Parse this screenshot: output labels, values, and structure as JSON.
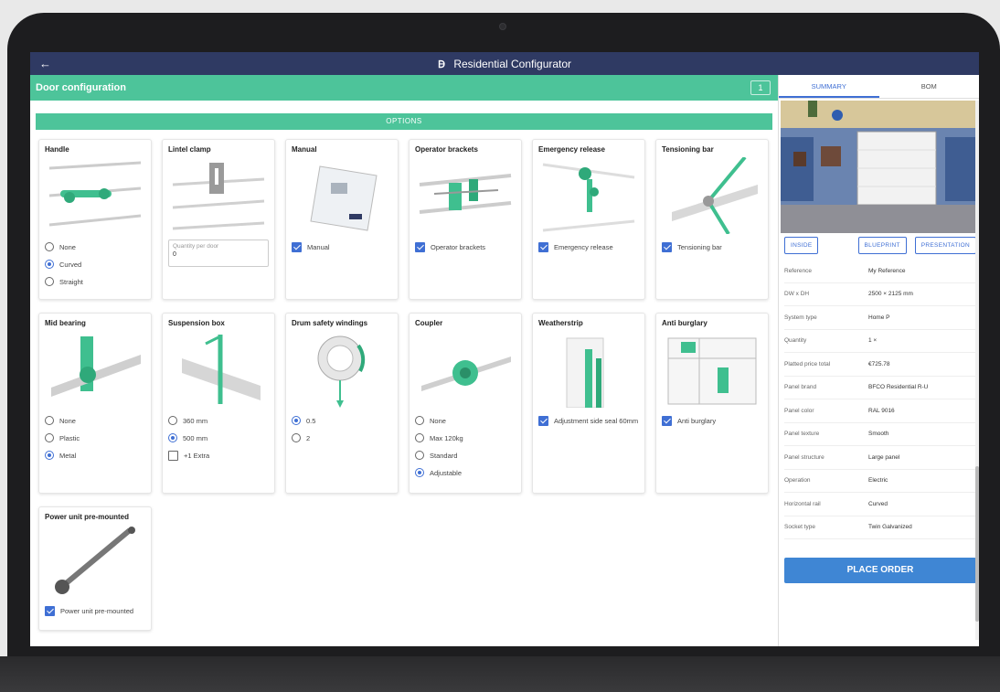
{
  "app": {
    "title": "Residential Configurator",
    "logo": "Ꟈ"
  },
  "config": {
    "title": "Door configuration",
    "badge": "1",
    "options_label": "OPTIONS"
  },
  "cards": {
    "handle": {
      "title": "Handle",
      "options": [
        "None",
        "Curved",
        "Straight"
      ],
      "selected": "Curved"
    },
    "lintel": {
      "title": "Lintel clamp",
      "qty_label": "Quantity per door",
      "qty_value": "0"
    },
    "manual": {
      "title": "Manual",
      "check": "Manual"
    },
    "operator": {
      "title": "Operator brackets",
      "check": "Operator brackets"
    },
    "emergency": {
      "title": "Emergency release",
      "check": "Emergency release"
    },
    "tensioning": {
      "title": "Tensioning bar",
      "check": "Tensioning bar"
    },
    "midbearing": {
      "title": "Mid bearing",
      "options": [
        "None",
        "Plastic",
        "Metal"
      ],
      "selected": "Metal"
    },
    "suspension": {
      "title": "Suspension box",
      "options": [
        "360 mm",
        "500 mm"
      ],
      "selected": "500 mm",
      "extra": "+1 Extra"
    },
    "drum": {
      "title": "Drum safety windings",
      "options": [
        "0.5",
        "2"
      ],
      "selected": "0.5"
    },
    "coupler": {
      "title": "Coupler",
      "options": [
        "None",
        "Max 120kg",
        "Standard",
        "Adjustable"
      ],
      "selected": "Adjustable"
    },
    "weatherstrip": {
      "title": "Weatherstrip",
      "check": "Adjustment side seal 60mm"
    },
    "antiburglary": {
      "title": "Anti burglary",
      "check": "Anti burglary"
    },
    "powerunit": {
      "title": "Power unit pre-mounted",
      "check": "Power unit pre-mounted"
    }
  },
  "sidebar": {
    "tabs": [
      "SUMMARY",
      "BOM"
    ],
    "buttons": [
      "INSIDE",
      "BLUEPRINT",
      "PRESENTATION"
    ],
    "specs": [
      {
        "k": "Reference",
        "v": "My Reference"
      },
      {
        "k": "DW x DH",
        "v": "2500 × 2125 mm"
      },
      {
        "k": "System type",
        "v": "Home P"
      },
      {
        "k": "Quantity",
        "v": "1 ×"
      },
      {
        "k": "Platted price total",
        "v": "€725.78"
      },
      {
        "k": "Panel brand",
        "v": "BFCO Residential R-U"
      },
      {
        "k": "Panel color",
        "v": "RAL 9016"
      },
      {
        "k": "Panel texture",
        "v": "Smooth"
      },
      {
        "k": "Panel structure",
        "v": "Large panel"
      },
      {
        "k": "Operation",
        "v": "Electric"
      },
      {
        "k": "Horizontal rail",
        "v": "Curved"
      },
      {
        "k": "Socket type",
        "v": "Twin Galvanized"
      }
    ],
    "order_label": "PLACE ORDER"
  },
  "colors": {
    "accent": "#4dc49a",
    "nav": "#2f3a63",
    "primary": "#3f6fd4",
    "order": "#3f86d4"
  }
}
